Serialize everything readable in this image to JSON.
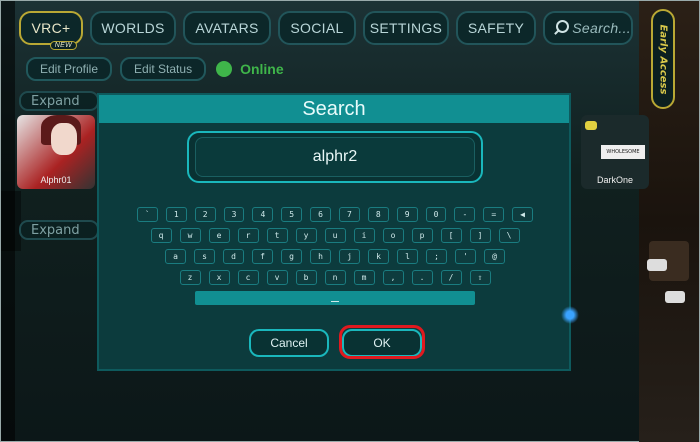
{
  "nav": {
    "vrc": "VRC+",
    "vrc_badge": "NEW",
    "worlds": "WORLDS",
    "avatars": "AVATARS",
    "social": "SOCIAL",
    "settings": "SETTINGS",
    "safety": "SAFETY",
    "search": "Search..."
  },
  "early_access": "Early Access",
  "profile": {
    "edit_profile": "Edit Profile",
    "edit_status": "Edit Status",
    "status": "Online"
  },
  "expand_label": "Expand",
  "cards": {
    "left_name": "Alphr01",
    "right_name": "DarkOne",
    "right_sign": "WHOLESOME"
  },
  "modal": {
    "title": "Search",
    "input_value": "alphr2",
    "cancel": "Cancel",
    "ok": "OK"
  },
  "keyboard": {
    "row1": [
      "`",
      "1",
      "2",
      "3",
      "4",
      "5",
      "6",
      "7",
      "8",
      "9",
      "0",
      "-",
      "=",
      "◀"
    ],
    "row2": [
      "q",
      "w",
      "e",
      "r",
      "t",
      "y",
      "u",
      "i",
      "o",
      "p",
      "[",
      "]",
      "\\"
    ],
    "row3": [
      "a",
      "s",
      "d",
      "f",
      "g",
      "h",
      "j",
      "k",
      "l",
      ";",
      "'",
      "@"
    ],
    "row4": [
      "z",
      "x",
      "c",
      "v",
      "b",
      "n",
      "m",
      ",",
      ".",
      "/",
      "⇧"
    ]
  },
  "colors": {
    "accent_teal": "#118f92",
    "highlight_red": "#e0191f",
    "online_green": "#3fb54a",
    "vrc_gold": "#b9a834"
  }
}
